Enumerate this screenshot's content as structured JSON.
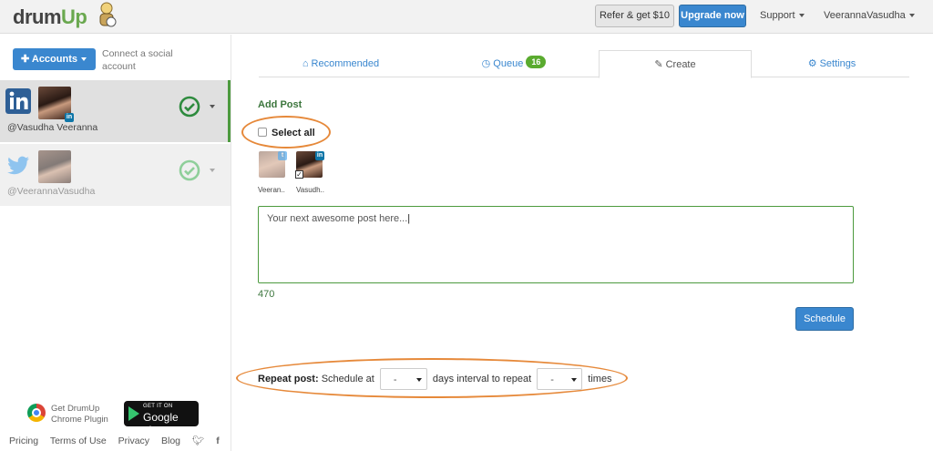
{
  "header": {
    "logo_text_a": "drum",
    "logo_text_b": "Up",
    "refer_label": "Refer & get $10",
    "upgrade_label": "Upgrade now",
    "support_label": "Support",
    "user_label": "VeerannaVasudha"
  },
  "sidebar": {
    "accounts_button": "Accounts",
    "connect_text": "Connect a social account",
    "accounts": [
      {
        "network_icon": "linkedin-icon",
        "handle": "@Vasudha Veeranna",
        "status_icon": "check-circle-icon",
        "active": true
      },
      {
        "network_icon": "twitter-icon",
        "handle": "@VeerannaVasudha",
        "status_icon": "check-circle-icon",
        "active": false
      }
    ],
    "chrome_plugin": "Get DrumUp Chrome Plugin",
    "gplay_small": "GET IT ON",
    "gplay_big": "Google play",
    "footer": [
      "Pricing",
      "Terms of Use",
      "Privacy",
      "Blog"
    ]
  },
  "tabs": [
    {
      "icon": "home-icon",
      "label": "Recommended"
    },
    {
      "icon": "clock-icon",
      "label": "Queue",
      "badge": "16"
    },
    {
      "icon": "pencil-icon",
      "label": "Create"
    },
    {
      "icon": "gear-icon",
      "label": "Settings"
    }
  ],
  "create": {
    "add_post_label": "Add Post",
    "select_all_label": "Select all",
    "selected_accounts": [
      "Veeran..",
      "Vasudh.."
    ],
    "post_text": "Your next awesome post here...",
    "char_count": "470",
    "schedule_label": "Schedule",
    "repeat_label": "Repeat post:",
    "schedule_at_label": "Schedule at",
    "days_value": "-",
    "days_interval_label": "days interval to repeat",
    "times_value": "-",
    "times_label": "times"
  },
  "colors": {
    "accent_blue": "#3a87cf",
    "green": "#4c9a3e",
    "highlight_orange": "#e6893a",
    "linkedin": "#0e76a8",
    "twitter": "#55acee"
  }
}
